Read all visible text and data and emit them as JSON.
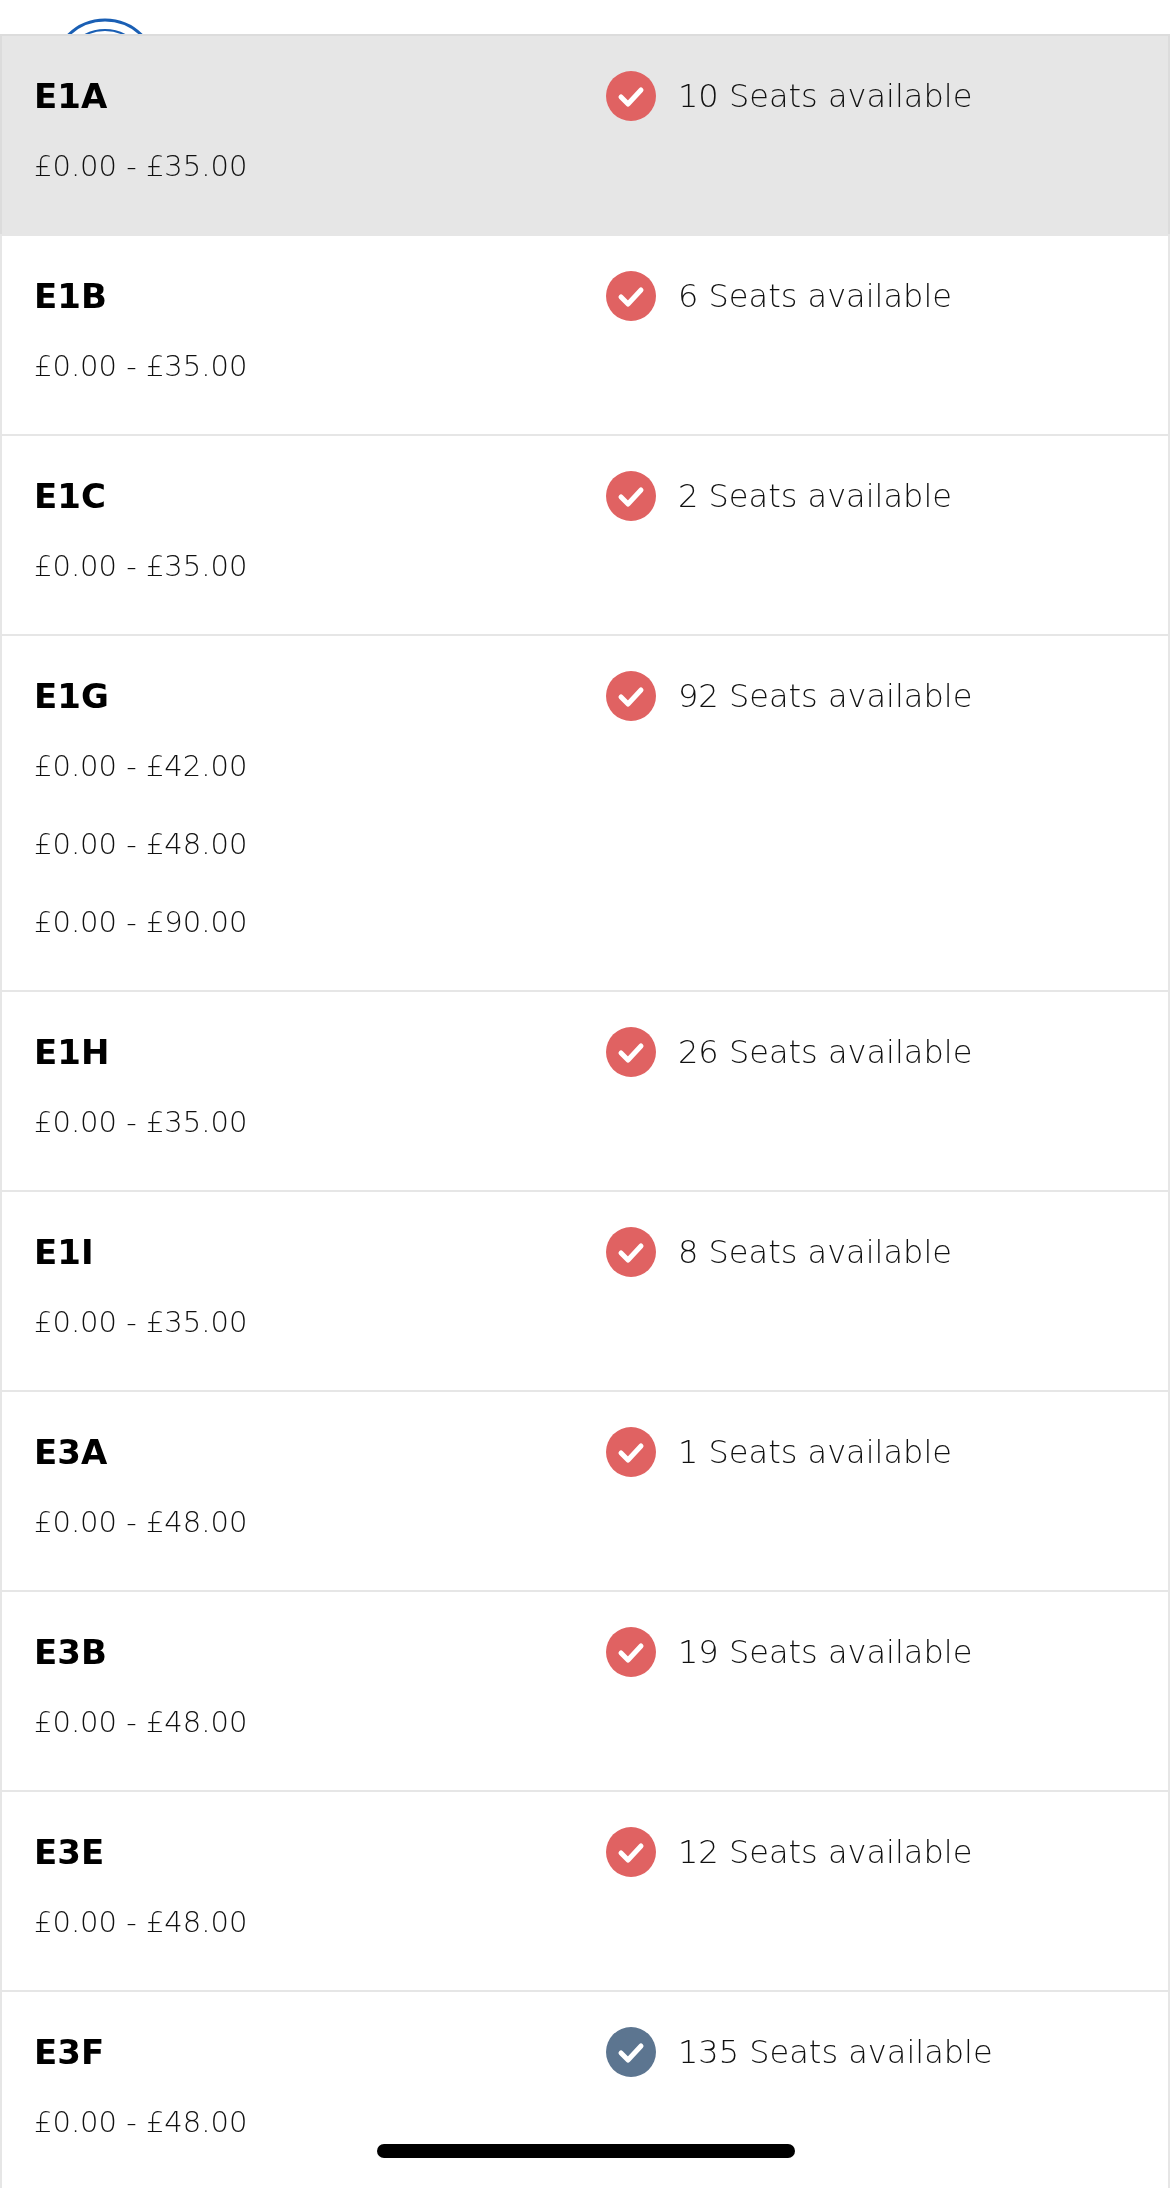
{
  "sections": [
    {
      "name": "E1A",
      "prices": [
        "£0.00 - £35.00"
      ],
      "availability": "10 Seats available",
      "color": "#e06262",
      "selected": true
    },
    {
      "name": "E1B",
      "prices": [
        "£0.00 - £35.00"
      ],
      "availability": "6 Seats available",
      "color": "#e06262",
      "selected": false
    },
    {
      "name": "E1C",
      "prices": [
        "£0.00 - £35.00"
      ],
      "availability": "2 Seats available",
      "color": "#e06262",
      "selected": false
    },
    {
      "name": "E1G",
      "prices": [
        "£0.00 - £42.00",
        "£0.00 - £48.00",
        "£0.00 - £90.00"
      ],
      "availability": "92 Seats available",
      "color": "#e06262",
      "selected": false
    },
    {
      "name": "E1H",
      "prices": [
        "£0.00 - £35.00"
      ],
      "availability": "26 Seats available",
      "color": "#e06262",
      "selected": false
    },
    {
      "name": "E1I",
      "prices": [
        "£0.00 - £35.00"
      ],
      "availability": "8 Seats available",
      "color": "#e06262",
      "selected": false
    },
    {
      "name": "E3A",
      "prices": [
        "£0.00 - £48.00"
      ],
      "availability": "1 Seats available",
      "color": "#e06262",
      "selected": false
    },
    {
      "name": "E3B",
      "prices": [
        "£0.00 - £48.00"
      ],
      "availability": "19 Seats available",
      "color": "#e06262",
      "selected": false
    },
    {
      "name": "E3E",
      "prices": [
        "£0.00 - £48.00"
      ],
      "availability": "12 Seats available",
      "color": "#e06262",
      "selected": false
    },
    {
      "name": "E3F",
      "prices": [
        "£0.00 - £48.00"
      ],
      "availability": "135 Seats available",
      "color": "#5c7590",
      "selected": false
    }
  ]
}
